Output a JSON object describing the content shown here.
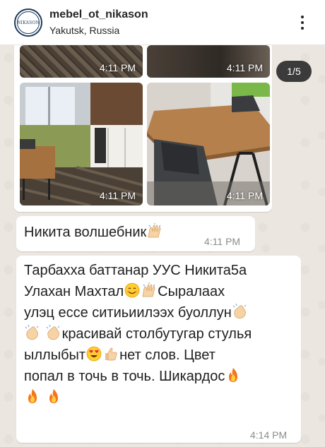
{
  "header": {
    "avatar_text": "NIKASON",
    "username": "mebel_ot_nikason",
    "location": "Yakutsk, Russia"
  },
  "media": {
    "counter": "1/5",
    "photos": [
      {
        "time": "4:11 PM"
      },
      {
        "time": "4:11 PM"
      },
      {
        "time": "4:11 PM"
      },
      {
        "time": "4:11 PM"
      }
    ]
  },
  "messages": [
    {
      "text": "Никита волшебник",
      "time": "4:11 PM"
    },
    {
      "line1": "Тарбахха баттанар УУС Никита5а",
      "line2a": "Улахан Махтал",
      "line2b": "Сыралаах",
      "line3": "улэц ессе ситиьиилээх буоллун",
      "line4": "красивай столбутугар стулья",
      "line5a": "ыллыбыт",
      "line5b": "нет слов. Цвет",
      "line6": "попал  в точь в точь. Шикардос",
      "time": "4:14 PM"
    }
  ],
  "icons": [
    "more-vertical-icon",
    "raised-hands-emoji",
    "smile-emoji",
    "clap-emoji",
    "heart-eyes-emoji",
    "thumbs-up-emoji",
    "fire-emoji"
  ],
  "colors": {
    "header_bg": "#ffffff",
    "chat_bg": "#ebe6df",
    "bubble_bg": "#ffffff",
    "counter_bg": "#3b3b3b",
    "time_color": "#8c8c8c"
  }
}
